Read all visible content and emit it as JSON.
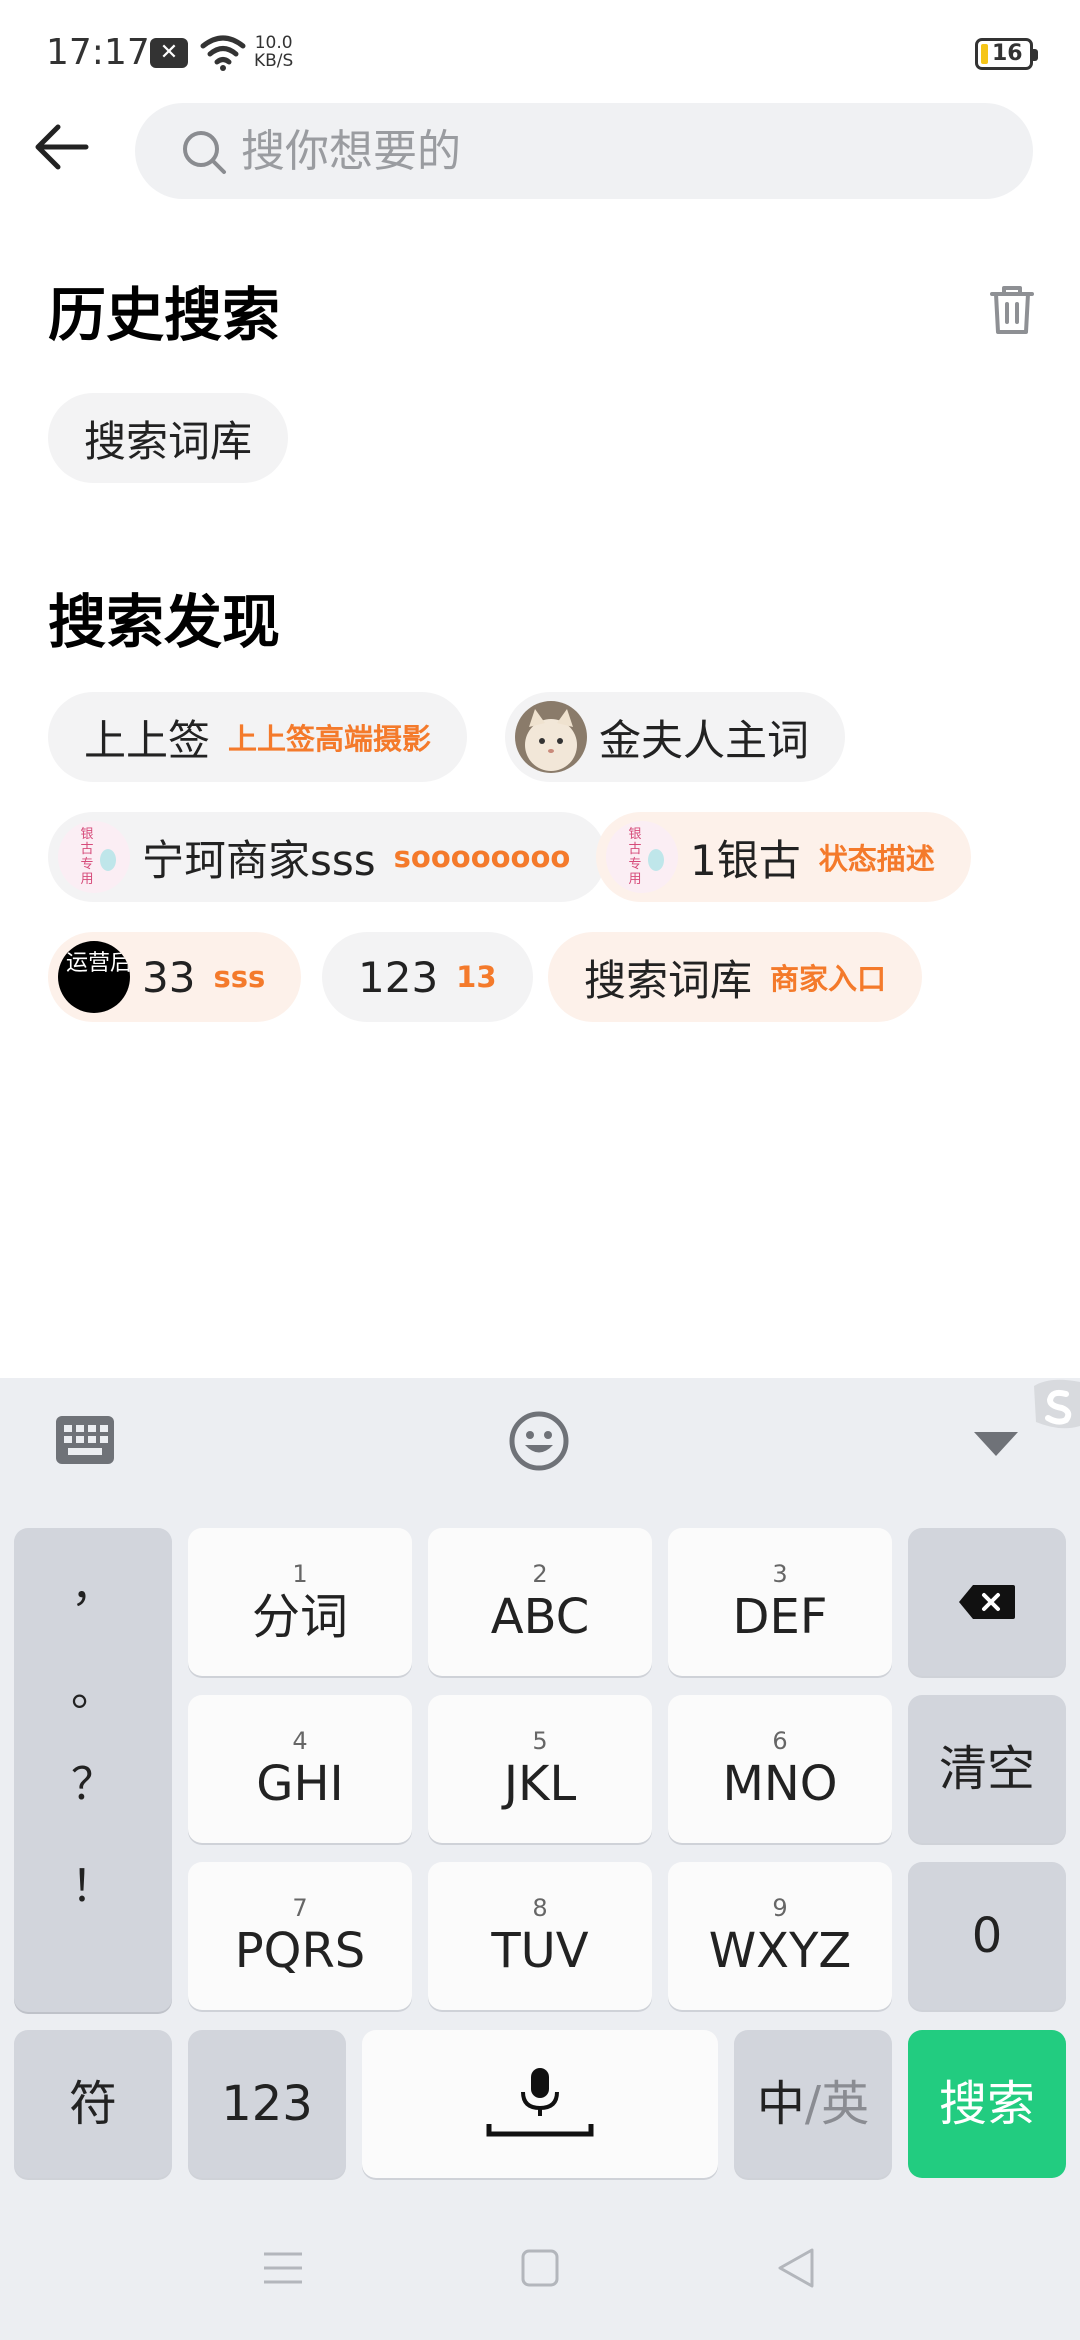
{
  "status_bar": {
    "time": "17:17",
    "notification_icon": "close-notification-icon",
    "net_speed_value": "10.0",
    "net_speed_unit": "KB/S",
    "battery_level": "16",
    "battery_fill_fraction": 0.16
  },
  "search": {
    "placeholder": "搜你想要的"
  },
  "history": {
    "title": "历史搜索",
    "items": [
      "搜索词库"
    ]
  },
  "discover": {
    "title": "搜索发现",
    "items": [
      {
        "label": "上上签",
        "tag": "上上签高端摄影",
        "avatar": null
      },
      {
        "label": "金夫人主词",
        "tag": "",
        "avatar": "cat-photo"
      },
      {
        "label": "宁珂商家sss",
        "tag": "soooooooo",
        "avatar": "logo-yingu"
      },
      {
        "label": "1银古",
        "tag": "状态描述",
        "avatar": "logo-yingu"
      },
      {
        "label": "33",
        "tag": "sss",
        "avatar": "logo-yunying"
      },
      {
        "label": "123",
        "tag": "13",
        "avatar": null
      },
      {
        "label": "搜索词库",
        "tag": "商家入口",
        "avatar": null
      }
    ],
    "avatar_text": {
      "logo_yingu": [
        "银",
        "古",
        "专",
        "用"
      ],
      "logo_yunying": "运营后台"
    }
  },
  "keyboard": {
    "punctuation": [
      "，",
      "。",
      "？",
      "！"
    ],
    "keys": [
      {
        "num": "1",
        "main": "分词"
      },
      {
        "num": "2",
        "main": "ABC"
      },
      {
        "num": "3",
        "main": "DEF"
      },
      {
        "num": "4",
        "main": "GHI"
      },
      {
        "num": "5",
        "main": "JKL"
      },
      {
        "num": "6",
        "main": "MNO"
      },
      {
        "num": "7",
        "main": "PQRS"
      },
      {
        "num": "8",
        "main": "TUV"
      },
      {
        "num": "9",
        "main": "WXYZ"
      }
    ],
    "clear": "清空",
    "zero": "0",
    "symbols": "符",
    "numbers": "123",
    "lang_zh": "中",
    "lang_sep": "/",
    "lang_en": "英",
    "search": "搜索"
  },
  "colors": {
    "accent_orange": "#f47a2b",
    "search_key_green": "#22cc80"
  }
}
